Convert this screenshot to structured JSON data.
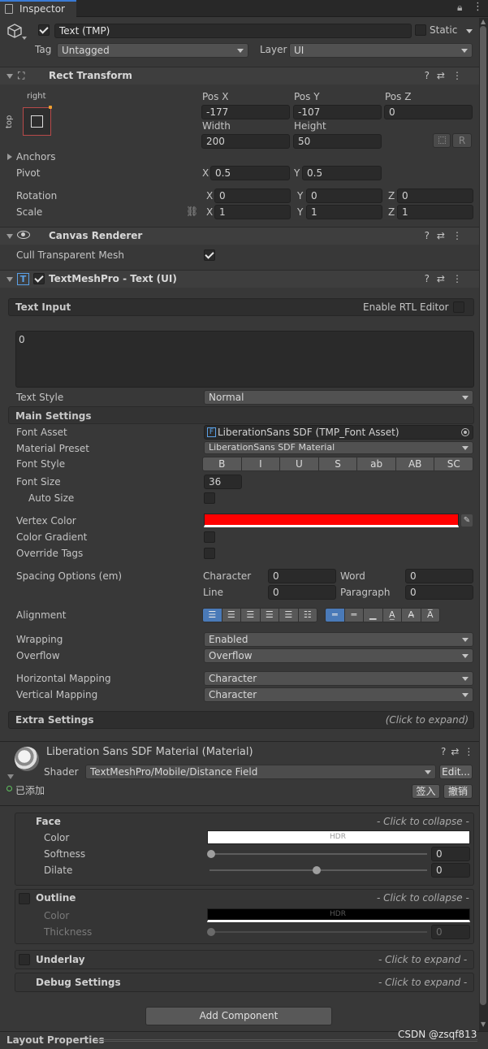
{
  "tab": {
    "title": "Inspector"
  },
  "object": {
    "name": "Text (TMP)",
    "active": true,
    "static_label": "Static",
    "tag_label": "Tag",
    "tag_value": "Untagged",
    "layer_label": "Layer",
    "layer_value": "UI"
  },
  "rect_transform": {
    "title": "Rect Transform",
    "anchor_h": "right",
    "anchor_v": "top",
    "pos_x_label": "Pos X",
    "pos_x": "-177",
    "pos_y_label": "Pos Y",
    "pos_y": "-107",
    "pos_z_label": "Pos Z",
    "pos_z": "0",
    "width_label": "Width",
    "width": "200",
    "height_label": "Height",
    "height": "50",
    "r_label": "R",
    "anchors_label": "Anchors",
    "pivot_label": "Pivot",
    "pivot_x": "0.5",
    "pivot_y": "0.5",
    "rotation_label": "Rotation",
    "rot_x": "0",
    "rot_y": "0",
    "rot_z": "0",
    "scale_label": "Scale",
    "scale_x": "1",
    "scale_y": "1",
    "scale_z": "1",
    "x": "X",
    "y": "Y",
    "z": "Z"
  },
  "canvas_renderer": {
    "title": "Canvas Renderer",
    "cull_label": "Cull Transparent Mesh",
    "cull": true
  },
  "tmp": {
    "title": "TextMeshPro - Text (UI)",
    "text_input_label": "Text Input",
    "rtl_label": "Enable RTL Editor",
    "text_value": "0",
    "text_style_label": "Text Style",
    "text_style": "Normal",
    "main_settings_label": "Main Settings",
    "font_asset_label": "Font Asset",
    "font_asset": "LiberationSans SDF (TMP_Font Asset)",
    "material_preset_label": "Material Preset",
    "material_preset": "LiberationSans SDF Material",
    "font_style_label": "Font Style",
    "font_style_buttons": [
      "B",
      "I",
      "U",
      "S",
      "ab",
      "AB",
      "SC"
    ],
    "font_size_label": "Font Size",
    "font_size": "36",
    "auto_size_label": "Auto Size",
    "vertex_color_label": "Vertex Color",
    "vertex_color": "#ff0000",
    "color_gradient_label": "Color Gradient",
    "override_tags_label": "Override Tags",
    "spacing_label": "Spacing Options (em)",
    "character_label": "Character",
    "character": "0",
    "word_label": "Word",
    "word": "0",
    "line_label": "Line",
    "line": "0",
    "paragraph_label": "Paragraph",
    "paragraph": "0",
    "alignment_label": "Alignment",
    "wrapping_label": "Wrapping",
    "wrapping": "Enabled",
    "overflow_label": "Overflow",
    "overflow": "Overflow",
    "hmap_label": "Horizontal Mapping",
    "hmap": "Character",
    "vmap_label": "Vertical Mapping",
    "vmap": "Character",
    "extra_label": "Extra Settings",
    "extra_hint": "(Click to expand)"
  },
  "material": {
    "title": "Liberation Sans SDF Material (Material)",
    "shader_label": "Shader",
    "shader": "TextMeshPro/Mobile/Distance Field",
    "edit_label": "Edit...",
    "added_label": "已添加",
    "checkin_label": "签入",
    "revert_label": "撤销",
    "face_label": "Face",
    "collapse_hint": "- Click to collapse -",
    "color_label": "Color",
    "hdr_label": "HDR",
    "softness_label": "Softness",
    "softness": "0",
    "softness_level": 0,
    "dilate_label": "Dilate",
    "dilate": "0",
    "dilate_level": 0.5,
    "outline_label": "Outline",
    "thickness_label": "Thickness",
    "thickness": "0",
    "underlay_label": "Underlay",
    "expand_hint": "- Click to expand -",
    "debug_label": "Debug Settings",
    "face_color": "#ffffff",
    "outline_color": "#000000"
  },
  "add_component_label": "Add Component",
  "layout_properties_label": "Layout Properties",
  "watermark": "CSDN @zsqf813"
}
